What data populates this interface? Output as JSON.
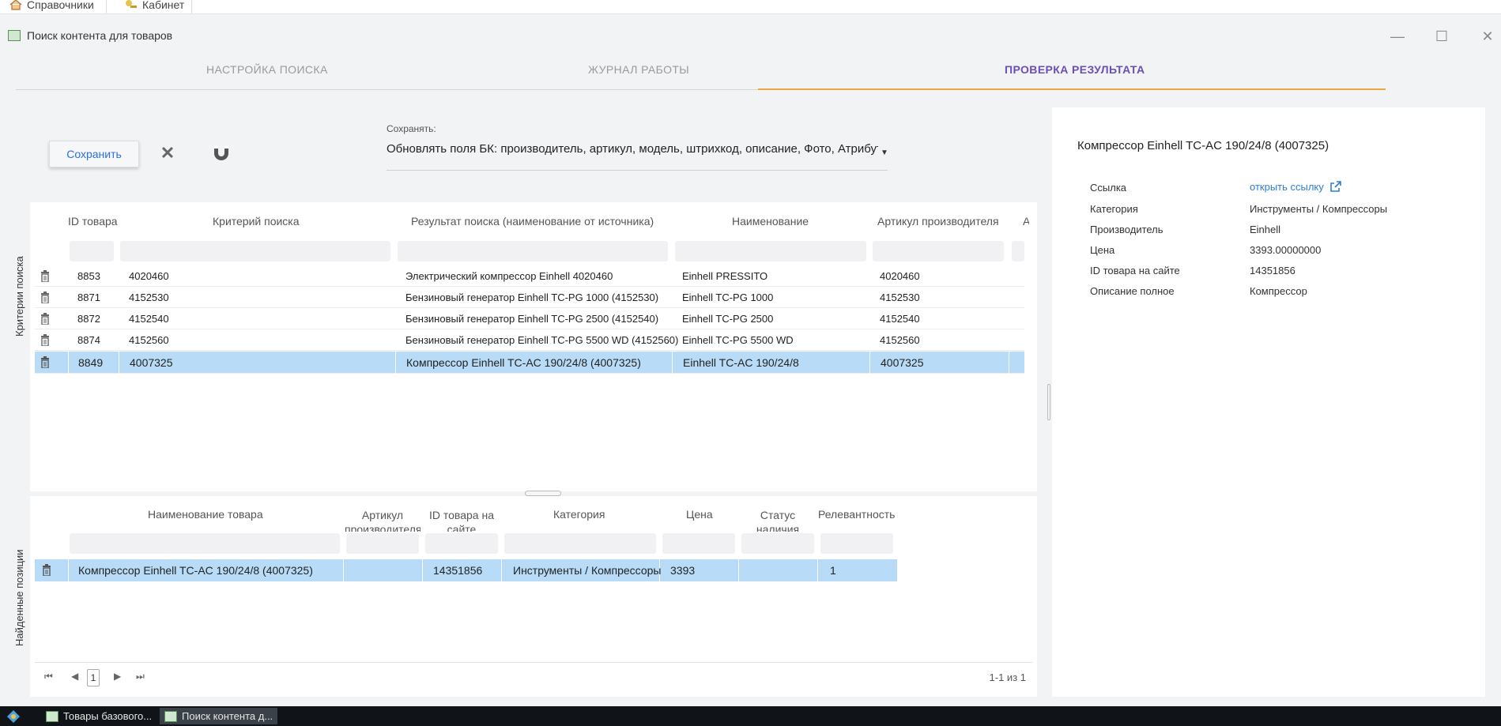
{
  "top_menu": {
    "item1": "Справочники",
    "item2": "Кабинет"
  },
  "window": {
    "title": "Поиск контента для товаров"
  },
  "tabs": [
    {
      "label": "НАСТРОЙКА ПОИСКА"
    },
    {
      "label": "ЖУРНАЛ РАБОТЫ"
    },
    {
      "label": "ПРОВЕРКА РЕЗУЛЬТАТА"
    }
  ],
  "toolbar": {
    "save_button": "Сохранить",
    "save_field_label": "Сохранять:",
    "save_field_value": "Обновлять поля БК: производитель, артикул, модель, штрихкод, описание, Фото, Атрибуты"
  },
  "search_panel": {
    "side_label": "Критерии поиска",
    "headers": [
      "ID товара",
      "Критерий поиска",
      "Результат поиска (наименование от источника)",
      "Наименование",
      "Артикул производителя",
      "А"
    ],
    "rows": [
      [
        "8853",
        "4020460",
        "Электрический компрессор Einhell 4020460",
        "Einhell PRESSITO",
        "4020460"
      ],
      [
        "8871",
        "4152530",
        "Бензиновый генератор Einhell TC-PG 1000 (4152530)",
        "Einhell TC-PG 1000",
        "4152530"
      ],
      [
        "8872",
        "4152540",
        "Бензиновый генератор Einhell TC-PG 2500 (4152540)",
        "Einhell TC-PG 2500",
        "4152540"
      ],
      [
        "8874",
        "4152560",
        "Бензиновый генератор Einhell TC-PG 5500 WD (4152560)",
        "Einhell TC-PG 5500 WD",
        "4152560"
      ],
      [
        "8849",
        "4007325",
        "Компрессор Einhell TC-AC 190/24/8 (4007325)",
        "Einhell TC-AC 190/24/8",
        "4007325"
      ]
    ]
  },
  "found_panel": {
    "side_label": "Найденные позиции",
    "headers": [
      "Наименование товара",
      "Артикул производителя",
      "ID товара на сайте",
      "Категория",
      "Цена",
      "Статус наличия",
      "Релевантность"
    ],
    "rows": [
      [
        "Компрессор Einhell TC-AC 190/24/8 (4007325)",
        "",
        "14351856",
        "Инструменты / Компрессоры",
        "3393",
        "",
        "1"
      ]
    ],
    "pager": {
      "page": "1",
      "count": "1-1 из 1"
    }
  },
  "details": {
    "title": "Компрессор Einhell TC-AC 190/24/8 (4007325)",
    "fields": [
      {
        "key": "Ссылка",
        "value": "открыть ссылку"
      },
      {
        "key": "Категория",
        "value": "Инструменты / Компрессоры"
      },
      {
        "key": "Производитель",
        "value": "Einhell"
      },
      {
        "key": "Цена",
        "value": "3393.00000000"
      },
      {
        "key": "ID товара на сайте",
        "value": "14351856"
      },
      {
        "key": "Описание полное",
        "value": "Компрессор"
      }
    ]
  },
  "taskbar": {
    "task1": "Товары базового...",
    "task2": "Поиск контента д..."
  }
}
